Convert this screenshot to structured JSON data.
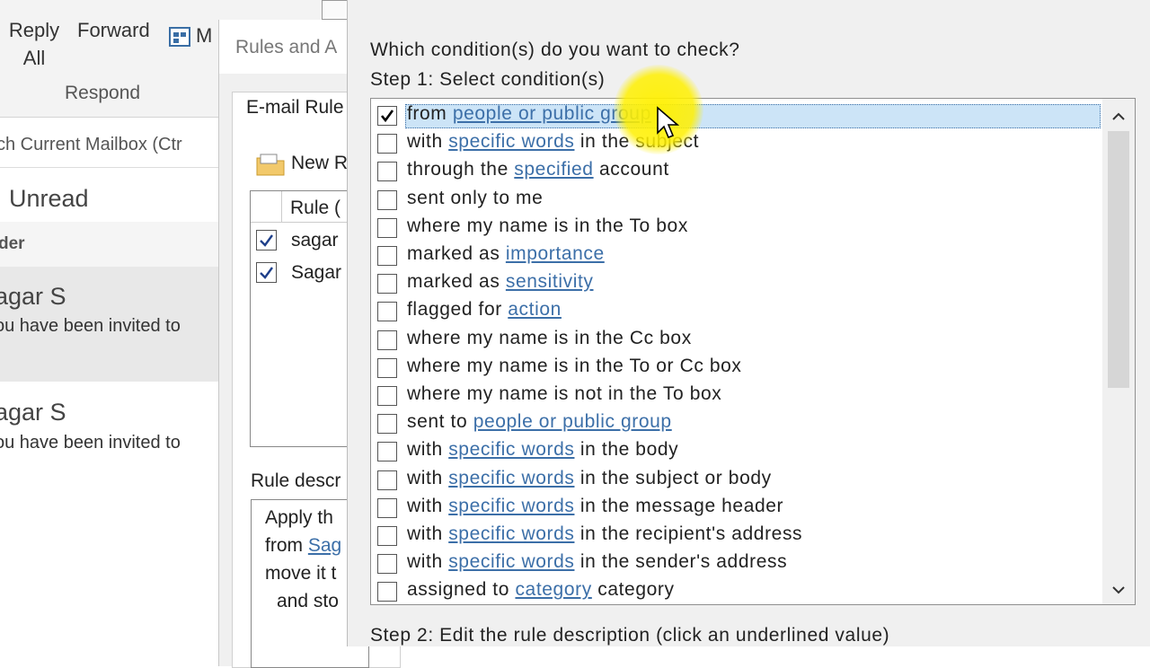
{
  "ribbon": {
    "reply_all_line1": "Reply",
    "reply_all_line2": "All",
    "forward_label": "Forward",
    "more_label": "M",
    "group_label": "Respond"
  },
  "mail": {
    "search_placeholder": "ch Current Mailbox (Ctr",
    "filter_unread": "Unread",
    "folder_label": "der",
    "items": [
      {
        "sender": "agar S",
        "preview": "ou have been invited to"
      },
      {
        "sender": "agar S",
        "preview": "ou have been invited to"
      }
    ]
  },
  "rules_dialog": {
    "title": "Rules and A",
    "tab_email_rules": "E-mail Rule",
    "new_rule_label": "New R",
    "column_rule": "Rule (",
    "rules": [
      {
        "name": "sagar",
        "checked": true
      },
      {
        "name": "Sagar",
        "checked": true
      }
    ],
    "description_label": "Rule descr",
    "description_lines": [
      "Apply th",
      "from ",
      "move it t",
      "and sto"
    ],
    "description_link": "Sag"
  },
  "wizard": {
    "question": "Which condition(s) do you want to check?",
    "step1": "Step 1: Select condition(s)",
    "step2": "Step 2: Edit the rule description (click an underlined value)",
    "conditions": [
      {
        "parts": [
          {
            "t": "from "
          },
          {
            "t": "people or public group",
            "link": true
          }
        ],
        "checked": true,
        "selected": true
      },
      {
        "parts": [
          {
            "t": "with "
          },
          {
            "t": "specific words",
            "link": true
          },
          {
            "t": " in the subject"
          }
        ],
        "checked": false
      },
      {
        "parts": [
          {
            "t": "through the "
          },
          {
            "t": "specified",
            "link": true
          },
          {
            "t": " account"
          }
        ],
        "checked": false
      },
      {
        "parts": [
          {
            "t": "sent only to me"
          }
        ],
        "checked": false
      },
      {
        "parts": [
          {
            "t": "where my name is in the To box"
          }
        ],
        "checked": false
      },
      {
        "parts": [
          {
            "t": "marked as "
          },
          {
            "t": "importance",
            "link": true
          }
        ],
        "checked": false
      },
      {
        "parts": [
          {
            "t": "marked as "
          },
          {
            "t": "sensitivity",
            "link": true
          }
        ],
        "checked": false
      },
      {
        "parts": [
          {
            "t": "flagged for "
          },
          {
            "t": "action",
            "link": true
          }
        ],
        "checked": false
      },
      {
        "parts": [
          {
            "t": "where my name is in the Cc box"
          }
        ],
        "checked": false
      },
      {
        "parts": [
          {
            "t": "where my name is in the To or Cc box"
          }
        ],
        "checked": false
      },
      {
        "parts": [
          {
            "t": "where my name is not in the To box"
          }
        ],
        "checked": false
      },
      {
        "parts": [
          {
            "t": "sent to "
          },
          {
            "t": "people or public group",
            "link": true
          }
        ],
        "checked": false
      },
      {
        "parts": [
          {
            "t": "with "
          },
          {
            "t": "specific words",
            "link": true
          },
          {
            "t": " in the body"
          }
        ],
        "checked": false
      },
      {
        "parts": [
          {
            "t": "with "
          },
          {
            "t": "specific words",
            "link": true
          },
          {
            "t": " in the subject or body"
          }
        ],
        "checked": false
      },
      {
        "parts": [
          {
            "t": "with "
          },
          {
            "t": "specific words",
            "link": true
          },
          {
            "t": " in the message header"
          }
        ],
        "checked": false
      },
      {
        "parts": [
          {
            "t": "with "
          },
          {
            "t": "specific words",
            "link": true
          },
          {
            "t": " in the recipient's address"
          }
        ],
        "checked": false
      },
      {
        "parts": [
          {
            "t": "with "
          },
          {
            "t": "specific words",
            "link": true
          },
          {
            "t": " in the sender's address"
          }
        ],
        "checked": false
      },
      {
        "parts": [
          {
            "t": "assigned to "
          },
          {
            "t": "category",
            "link": true
          },
          {
            "t": " category"
          }
        ],
        "checked": false
      }
    ]
  },
  "colors": {
    "link": "#3c6fa8",
    "selection": "#cce4f7",
    "cursor_highlight": "#fff000"
  }
}
